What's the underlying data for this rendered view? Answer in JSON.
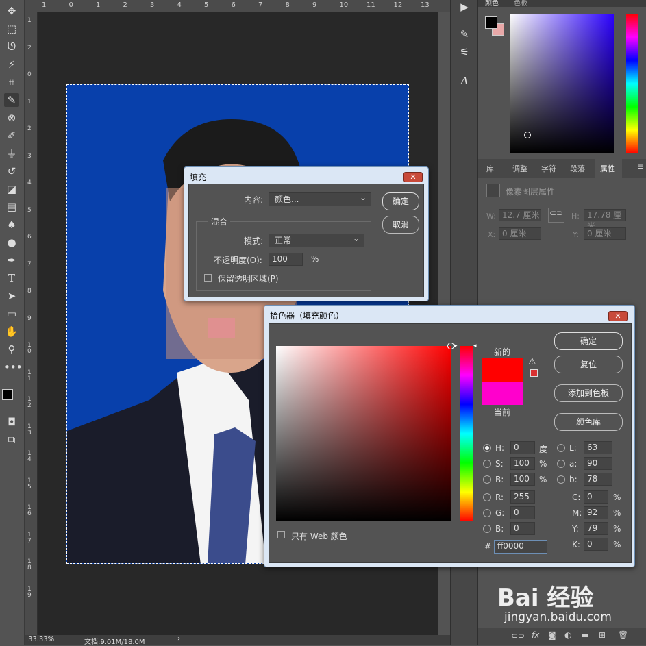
{
  "status": {
    "zoom": "33.33%",
    "doc": "文档:9.01M/18.0M"
  },
  "ruler": {
    "top": [
      "1",
      "0",
      "1",
      "2",
      "3",
      "4",
      "5",
      "6",
      "7",
      "8",
      "9",
      "10",
      "11",
      "12",
      "13"
    ],
    "left": [
      "1",
      "2",
      "0",
      "1",
      "2",
      "3",
      "4",
      "5",
      "6",
      "7",
      "8",
      "9",
      "10",
      "11",
      "12",
      "13",
      "14",
      "15",
      "16",
      "17",
      "18",
      "19"
    ]
  },
  "toolbar": {
    "icons": [
      "move-icon",
      "marquee-icon",
      "lasso-icon",
      "magic-wand-icon",
      "crop-icon",
      "eyedropper-icon",
      "patch-icon",
      "brush-icon",
      "stamp-icon",
      "history-brush-icon",
      "eraser-icon",
      "gradient-icon",
      "blur-icon",
      "dodge-icon",
      "pen-icon",
      "type-icon",
      "path-select-icon",
      "rectangle-icon",
      "hand-icon",
      "zoom-icon",
      "more-icon"
    ]
  },
  "right_panel": {
    "top_tabs": [
      "颜色",
      "色板"
    ],
    "mid_tabs": [
      "库",
      "调整",
      "字符",
      "段落",
      "属性"
    ],
    "properties_title": "像素图层属性",
    "w_label": "W:",
    "w_value": "12.7 厘米",
    "h_label": "H:",
    "h_value": "17.78 厘米",
    "x_label": "X:",
    "x_value": "0 厘米",
    "y_label": "Y:",
    "y_value": "0 厘米",
    "watermark_brand": "Bai 经验",
    "watermark_url": "jingyan.baidu.com"
  },
  "fill_dialog": {
    "title": "填充",
    "content_label": "内容:",
    "content_value": "颜色...",
    "blend_group": "混合",
    "mode_label": "模式:",
    "mode_value": "正常",
    "opacity_label": "不透明度(O):",
    "opacity_value": "100",
    "opacity_unit": "%",
    "preserve_label": "保留透明区域(P)",
    "ok": "确定",
    "cancel": "取消"
  },
  "picker_dialog": {
    "title": "拾色器（填充颜色）",
    "ok": "确定",
    "reset": "复位",
    "add_swatch": "添加到色板",
    "color_library": "颜色库",
    "new_label": "新的",
    "current_label": "当前",
    "new_color": "#ff0000",
    "current_color": "#ff00cc",
    "web_only": "只有 Web 颜色",
    "hsb": [
      {
        "label": "H:",
        "value": "0",
        "unit": "度"
      },
      {
        "label": "S:",
        "value": "100",
        "unit": "%"
      },
      {
        "label": "B:",
        "value": "100",
        "unit": "%"
      }
    ],
    "rgb": [
      {
        "label": "R:",
        "value": "255"
      },
      {
        "label": "G:",
        "value": "0"
      },
      {
        "label": "B:",
        "value": "0"
      }
    ],
    "lab": [
      {
        "label": "L:",
        "value": "63"
      },
      {
        "label": "a:",
        "value": "90"
      },
      {
        "label": "b:",
        "value": "78"
      }
    ],
    "cmyk": [
      {
        "label": "C:",
        "value": "0",
        "unit": "%"
      },
      {
        "label": "M:",
        "value": "92",
        "unit": "%"
      },
      {
        "label": "Y:",
        "value": "79",
        "unit": "%"
      },
      {
        "label": "K:",
        "value": "0",
        "unit": "%"
      }
    ],
    "hex_label": "#",
    "hex_value": "ff0000"
  }
}
